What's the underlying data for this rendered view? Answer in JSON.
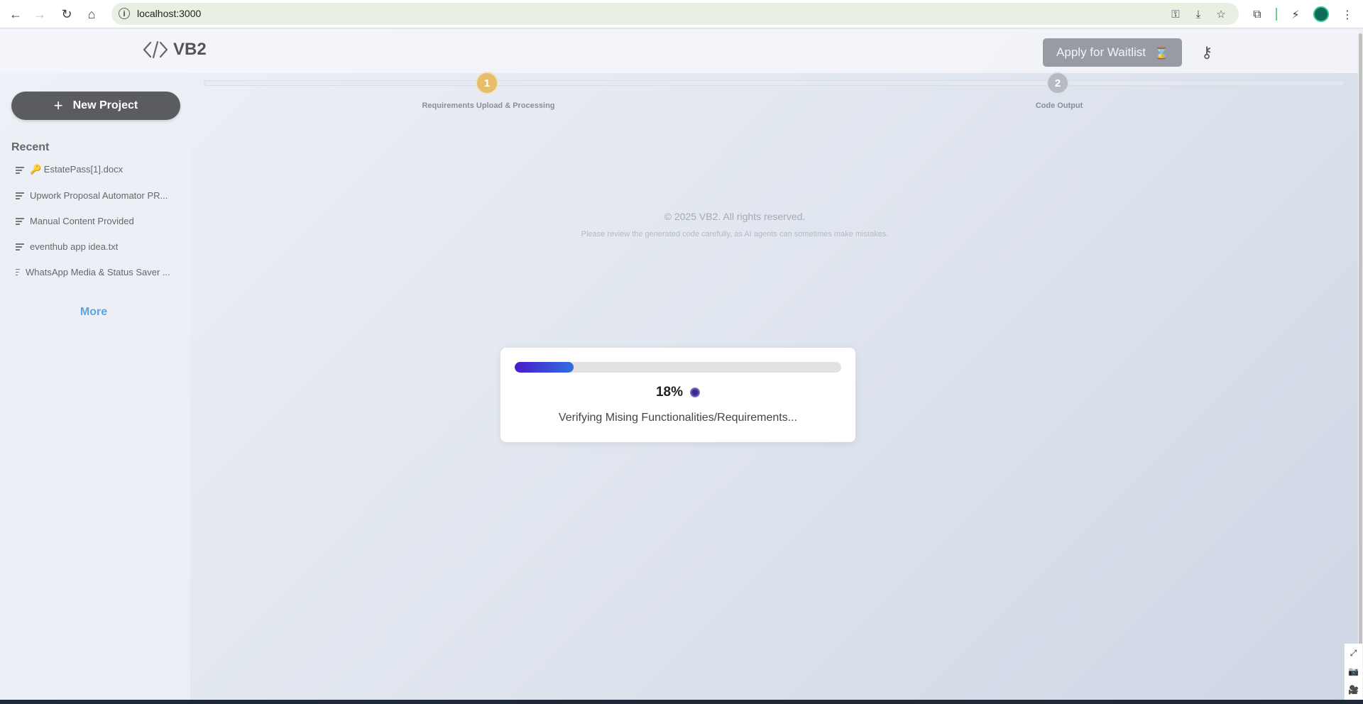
{
  "browser": {
    "url": "localhost:3000",
    "back_icon": "arrow-left-icon",
    "forward_icon": "arrow-right-icon",
    "reload_icon": "reload-icon",
    "home_icon": "home-icon"
  },
  "app": {
    "logo_text": "VB2",
    "waitlist_label": "Apply for Waitlist",
    "waitlist_icon": "hourglass-icon",
    "key_icon": "key-icon"
  },
  "sidebar": {
    "new_project_label": "New Project",
    "recent_title": "Recent",
    "items": [
      {
        "label": "🔑 EstatePass[1].docx"
      },
      {
        "label": "Upwork Proposal Automator PR..."
      },
      {
        "label": "Manual Content Provided"
      },
      {
        "label": "eventhub app idea.txt"
      },
      {
        "label": "WhatsApp Media & Status Saver ..."
      }
    ],
    "more_label": "More"
  },
  "stepper": {
    "steps": [
      {
        "number": "1",
        "label": "Requirements Upload & Processing",
        "state": "active",
        "color": "#e6bd6a"
      },
      {
        "number": "2",
        "label": "Code Output",
        "state": "pending",
        "color": "#b6bbc3"
      }
    ]
  },
  "footer": {
    "copyright": "© 2025 VB2. All rights reserved.",
    "disclaimer": "Please review the generated code carefully, as AI agents can sometimes make mistakes."
  },
  "progress": {
    "percent": 18,
    "percent_label": "18%",
    "status": "Verifying Mising Functionalities/Requirements...",
    "bar_colors": [
      "#4a1cc9",
      "#2f6fe0"
    ]
  }
}
